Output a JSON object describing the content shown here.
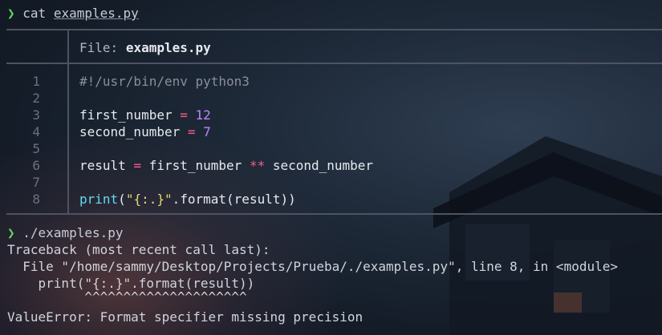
{
  "terminal": {
    "prompt_symbol": "❯",
    "command1": {
      "cmd": "cat",
      "arg": "examples.py"
    },
    "bat_header": {
      "label": "File:",
      "filename": "examples.py"
    },
    "code_lines": [
      {
        "num": "1",
        "tokens": [
          {
            "t": "#!/usr/bin/env python3",
            "k": "comment"
          }
        ]
      },
      {
        "num": "2",
        "tokens": []
      },
      {
        "num": "3",
        "tokens": [
          {
            "t": "first_number ",
            "k": "plain"
          },
          {
            "t": "=",
            "k": "op"
          },
          {
            "t": " ",
            "k": "plain"
          },
          {
            "t": "12",
            "k": "num"
          }
        ]
      },
      {
        "num": "4",
        "tokens": [
          {
            "t": "second_number ",
            "k": "plain"
          },
          {
            "t": "=",
            "k": "op"
          },
          {
            "t": " ",
            "k": "plain"
          },
          {
            "t": "7",
            "k": "num"
          }
        ]
      },
      {
        "num": "5",
        "tokens": []
      },
      {
        "num": "6",
        "tokens": [
          {
            "t": "result ",
            "k": "plain"
          },
          {
            "t": "=",
            "k": "op"
          },
          {
            "t": " first_number ",
            "k": "plain"
          },
          {
            "t": "**",
            "k": "op"
          },
          {
            "t": " second_number",
            "k": "plain"
          }
        ]
      },
      {
        "num": "7",
        "tokens": []
      },
      {
        "num": "8",
        "tokens": [
          {
            "t": "print",
            "k": "fn"
          },
          {
            "t": "(",
            "k": "plain"
          },
          {
            "t": "\"{:.}\"",
            "k": "str"
          },
          {
            "t": ".format(result))",
            "k": "plain"
          }
        ]
      }
    ],
    "command2": {
      "cmd": "./examples.py"
    },
    "output_lines": [
      "Traceback (most recent call last):",
      "  File \"/home/sammy/Desktop/Projects/Prueba/./examples.py\", line 8, in <module>",
      "    print(\"{:.}\".format(result))",
      "          ^^^^^^^^^^^^^^^^^^^^^",
      "ValueError: Format specifier missing precision"
    ]
  },
  "colors": {
    "prompt": "#5fd75f",
    "operator": "#ff5c8a",
    "number": "#c183ff",
    "function": "#66d9ef",
    "string": "#e6db74",
    "comment": "#8a8f98"
  }
}
